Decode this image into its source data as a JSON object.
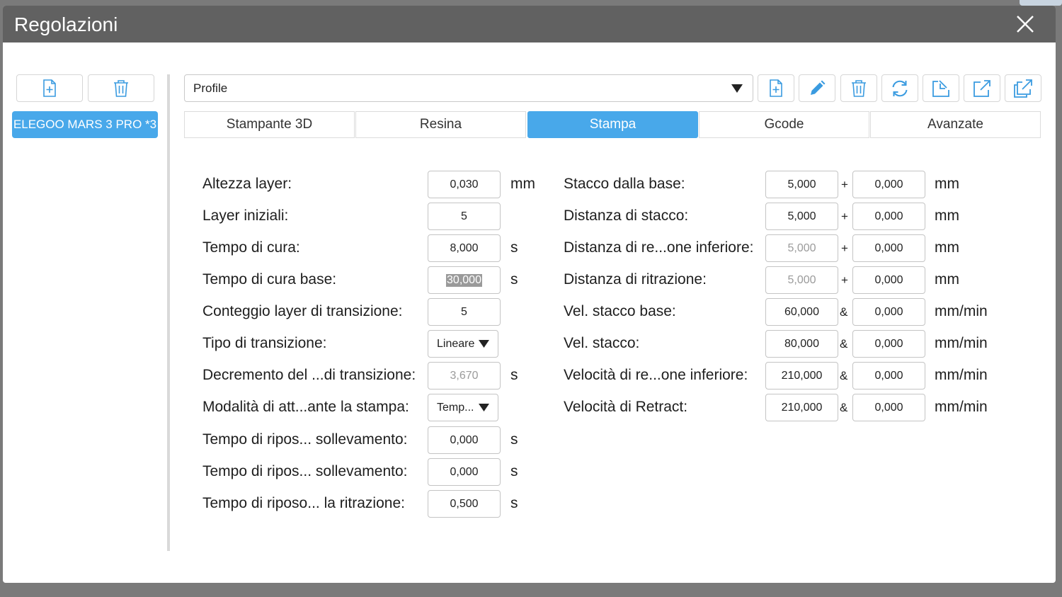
{
  "window": {
    "title": "Regolazioni"
  },
  "printers": {
    "items": [
      "ELEGOO MARS 3 PRO *3"
    ]
  },
  "profile": {
    "selected": "Profile"
  },
  "tabs": [
    "Stampante 3D",
    "Resina",
    "Stampa",
    "Gcode",
    "Avanzate"
  ],
  "active_tab": "Stampa",
  "left_params": [
    {
      "label": "Altezza layer:",
      "value": "0,030",
      "unit": "mm"
    },
    {
      "label": "Layer iniziali:",
      "value": "5",
      "unit": ""
    },
    {
      "label": "Tempo di cura:",
      "value": "8,000",
      "unit": "s"
    },
    {
      "label": "Tempo di cura base:",
      "value": "30,000",
      "unit": "s"
    },
    {
      "label": "Conteggio layer di transizione:",
      "value": "5",
      "unit": ""
    },
    {
      "label": "Tipo di transizione:",
      "value": "Lineare",
      "unit": ""
    },
    {
      "label": "Decremento del ...di transizione:",
      "value": "3,670",
      "unit": "s"
    },
    {
      "label": "Modalità di att...ante la stampa:",
      "value": "Temp...",
      "unit": ""
    },
    {
      "label": "Tempo di ripos... sollevamento:",
      "value": "0,000",
      "unit": "s"
    },
    {
      "label": "Tempo di ripos... sollevamento:",
      "value": "0,000",
      "unit": "s"
    },
    {
      "label": "Tempo di riposo... la ritrazione:",
      "value": "0,500",
      "unit": "s"
    }
  ],
  "right_params": [
    {
      "label": "Stacco dalla base:",
      "value1": "5,000",
      "sep": "+",
      "value2": "0,000",
      "unit": "mm"
    },
    {
      "label": "Distanza di stacco:",
      "value1": "5,000",
      "sep": "+",
      "value2": "0,000",
      "unit": "mm"
    },
    {
      "label": "Distanza di re...one inferiore:",
      "value1": "5,000",
      "sep": "+",
      "value2": "0,000",
      "unit": "mm"
    },
    {
      "label": "Distanza di ritrazione:",
      "value1": "5,000",
      "sep": "+",
      "value2": "0,000",
      "unit": "mm"
    },
    {
      "label": "Vel. stacco base:",
      "value1": "60,000",
      "sep": "&",
      "value2": "0,000",
      "unit": "mm/min"
    },
    {
      "label": "Vel. stacco:",
      "value1": "80,000",
      "sep": "&",
      "value2": "0,000",
      "unit": "mm/min"
    },
    {
      "label": "Velocità di re...one inferiore:",
      "value1": "210,000",
      "sep": "&",
      "value2": "0,000",
      "unit": "mm/min"
    },
    {
      "label": "Velocità di Retract:",
      "value1": "210,000",
      "sep": "&",
      "value2": "0,000",
      "unit": "mm/min"
    }
  ],
  "icons": {
    "left_toolbar": [
      "new-file-icon",
      "trash-icon"
    ],
    "profile_toolbar": [
      "new-file-icon",
      "pencil-icon",
      "trash-icon",
      "refresh-icon",
      "import-icon",
      "export-icon",
      "export-all-icon"
    ],
    "close": "close-icon"
  },
  "colors": {
    "accent": "#48a8ea",
    "titlebar": "#616161",
    "icon": "#3a9be0"
  }
}
